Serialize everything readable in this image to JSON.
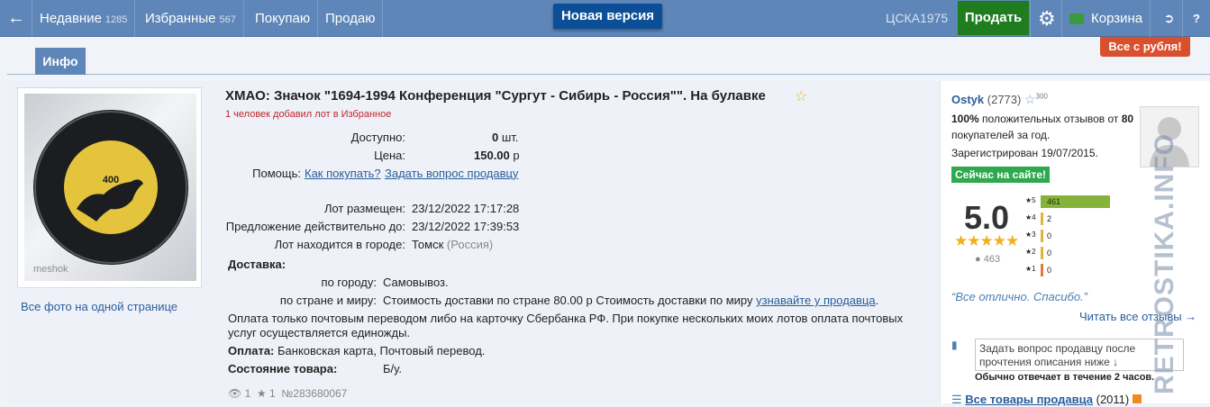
{
  "topbar": {
    "recent_label": "Недавние",
    "recent_count": "1285",
    "favorites_label": "Избранные",
    "favorites_count": "567",
    "buying": "Покупаю",
    "selling": "Продаю",
    "new_version": "Новая версия",
    "username": "ЦСКА1975",
    "sell_button": "Продать",
    "cart": "Корзина",
    "all_from_ruble": "Все с рубля!"
  },
  "tabs": {
    "info": "Инфо"
  },
  "photo": {
    "all_photos_link": "Все фото на одной странице",
    "watermark": "meshok",
    "badge_number": "400"
  },
  "lot": {
    "title": "ХМАО: Значок \"1694-1994 Конференция \"Сургут - Сибирь - Россия\"\". На булавке",
    "favorites_note": "1 человек добавил лот в Избранное",
    "available_label": "Доступно:",
    "available_value": "0",
    "available_unit": "шт.",
    "price_label": "Цена:",
    "price_value": "150.00",
    "price_unit": "р",
    "help_label": "Помощь:",
    "help_how_to_buy": "Как покупать?",
    "help_ask_seller": "Задать вопрос продавцу",
    "placed_label": "Лот размещен:",
    "placed_value": "23/12/2022 17:17:28",
    "valid_label": "Предложение действительно до:",
    "valid_value": "23/12/2022 17:39:53",
    "city_label": "Лот находится в городе:",
    "city_value": "Томск",
    "city_country": "(Россия)",
    "delivery_label": "Доставка:",
    "delivery_city_label": "по городу:",
    "delivery_city_value": "Самовывоз.",
    "delivery_world_label": "по стране и миру:",
    "delivery_world_value": "Стоимость доставки по стране 80.00 р Стоимость доставки по миру",
    "delivery_world_link": "узнавайте у продавца",
    "payment_note": "Оплата только почтовым переводом либо на карточку Сбербанка РФ. При покупке нескольких моих лотов оплата почтовых услуг осуществляется единожды.",
    "payment_label": "Оплата:",
    "payment_value": "Банковская карта, Почтовый перевод.",
    "condition_label": "Состояние товара:",
    "condition_value": "Б/у.",
    "views": "1",
    "stars": "1",
    "lot_number": "№283680067"
  },
  "seller": {
    "name": "Ostyk",
    "rating": "(2773)",
    "star_count": "300",
    "positive_pct": "100%",
    "positive_text": "положительных отзывов от",
    "buyers_count": "80",
    "buyers_text": "покупателей за год.",
    "registered": "Зарегистрирован 19/07/2015.",
    "online_badge": "Сейчас на сайте!",
    "score": "5.0",
    "reviews_count": "463",
    "distribution": [
      {
        "star": "5",
        "count": 461
      },
      {
        "star": "4",
        "count": 2
      },
      {
        "star": "3",
        "count": 0
      },
      {
        "star": "2",
        "count": 0
      },
      {
        "star": "1",
        "count": 0
      }
    ],
    "review_quote": "“Все отлично. Спасибо.”",
    "read_all": "Читать все отзывы →",
    "ask_placeholder": "Задать вопрос продавцу после прочтения описания ниже ↓",
    "response_time": "Обычно отвечает в течение 2 часов.",
    "all_goods": "Все товары продавца",
    "all_goods_count": "(2011)"
  },
  "colors": {
    "topbar": "#5e86b8",
    "sell": "#1f7d1f",
    "new_version": "#0d4f97",
    "all_rub": "#d9502f",
    "star": "#f2b01e",
    "bar5": "#86b43a",
    "bar_low": "#e0b43a"
  }
}
